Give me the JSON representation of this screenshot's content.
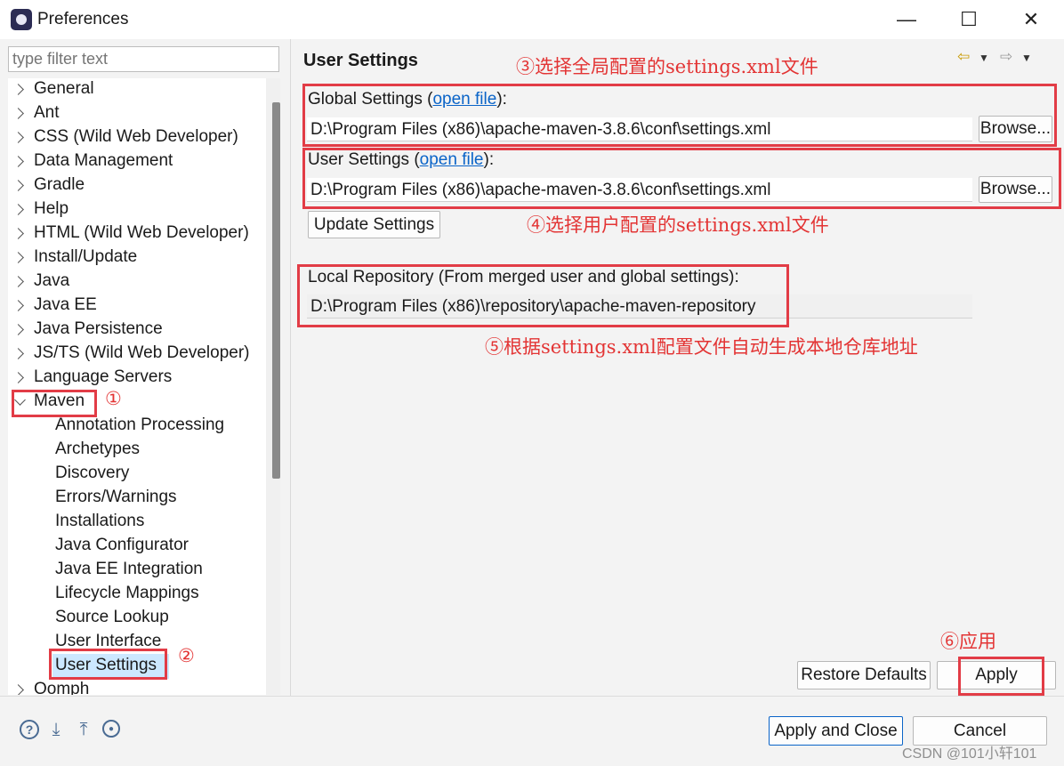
{
  "window": {
    "title": "Preferences",
    "minimize": "—",
    "maximize": "☐",
    "close": "✕"
  },
  "filter": {
    "placeholder": "type filter text"
  },
  "tree": {
    "items": [
      "General",
      "Ant",
      "CSS (Wild Web Developer)",
      "Data Management",
      "Gradle",
      "Help",
      "HTML (Wild Web Developer)",
      "Install/Update",
      "Java",
      "Java EE",
      "Java Persistence",
      "JS/TS (Wild Web Developer)",
      "Language Servers",
      "Maven"
    ],
    "maven_children": [
      "Annotation Processing",
      "Archetypes",
      "Discovery",
      "Errors/Warnings",
      "Installations",
      "Java Configurator",
      "Java EE Integration",
      "Lifecycle Mappings",
      "Source Lookup",
      "User Interface",
      "User Settings"
    ],
    "after": "Oomph",
    "selected": "User Settings"
  },
  "page": {
    "heading": "User Settings",
    "global_label": "Global Settings (",
    "global_link": "open file",
    "global_suffix": "):",
    "global_value": "D:\\Program Files (x86)\\apache-maven-3.8.6\\conf\\settings.xml",
    "user_label": "User Settings (",
    "user_link": "open file",
    "user_suffix": "):",
    "user_value": "D:\\Program Files (x86)\\apache-maven-3.8.6\\conf\\settings.xml",
    "browse": "Browse...",
    "update_settings": "Update Settings",
    "local_repo_label": "Local Repository (From merged user and global settings):",
    "local_repo_value": "D:\\Program Files (x86)\\repository\\apache-maven-repository",
    "restore_defaults": "Restore Defaults",
    "apply": "Apply"
  },
  "annotations": {
    "a1": "①",
    "a2": "②",
    "a3": "③选择全局配置的settings.xml文件",
    "a4": "④选择用户配置的settings.xml文件",
    "a5": "⑤根据settings.xml配置文件自动生成本地仓库地址",
    "a6": "⑥应用"
  },
  "footer": {
    "apply_and_close": "Apply and Close",
    "cancel": "Cancel",
    "help_icon": "?",
    "watermark": "CSDN @101小轩101"
  },
  "colors": {
    "annotation": "#e23c46",
    "link": "#0a64c8",
    "selection": "#cce8ff"
  }
}
